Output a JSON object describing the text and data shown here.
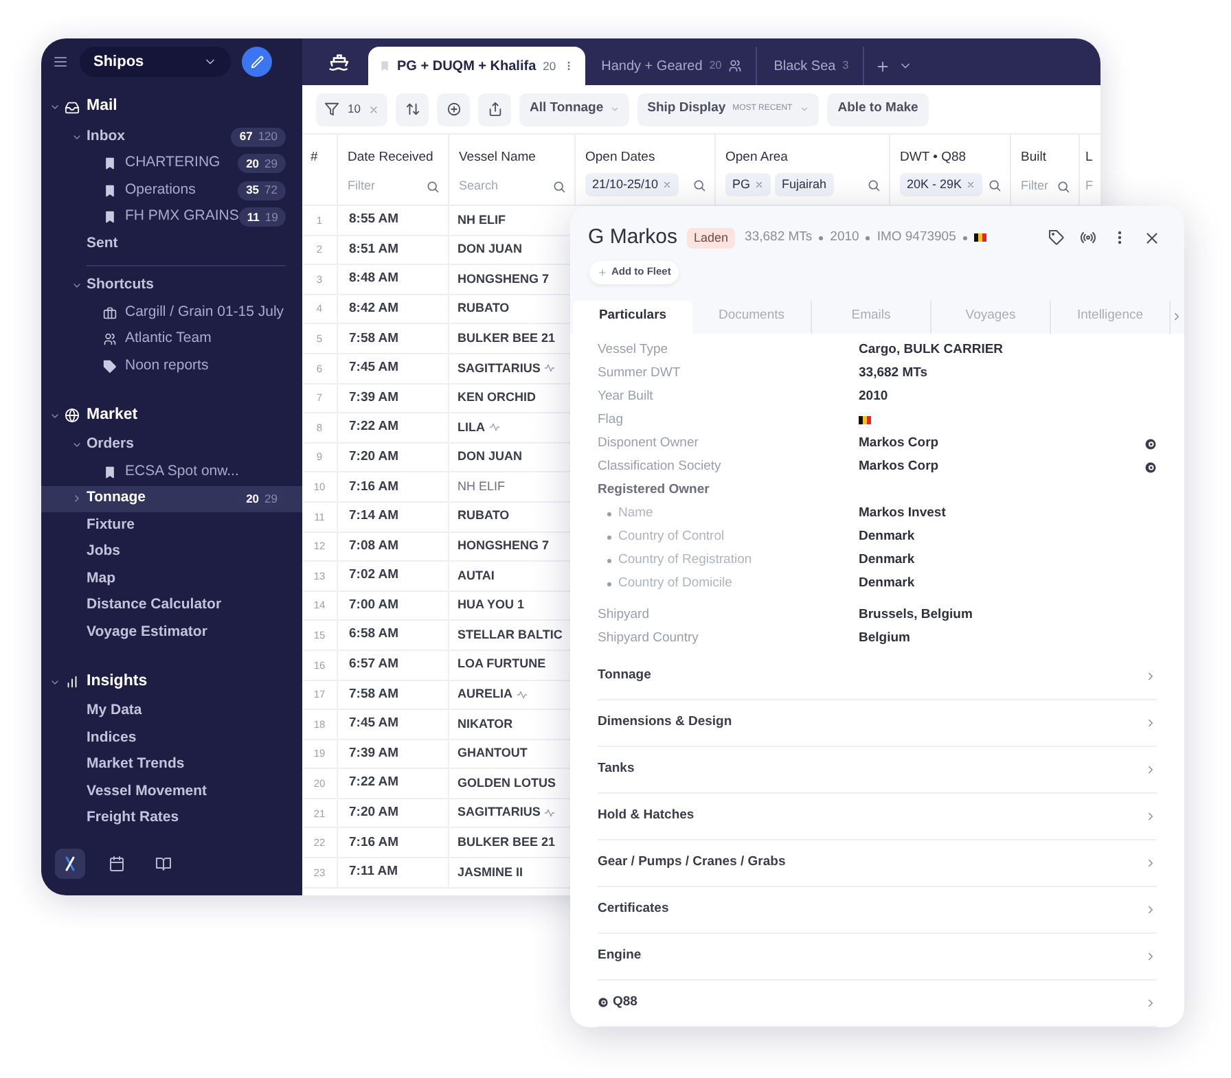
{
  "sidebar": {
    "workspace": "Shipos",
    "sections": [
      {
        "title": "Mail",
        "expanded": true,
        "items": [
          {
            "kind": "group",
            "label": "Inbox",
            "expanded": true,
            "selected": false,
            "counts": [
              "67",
              "120"
            ],
            "children": [
              {
                "kind": "bookmark",
                "label": "CHARTERING",
                "selected": false,
                "counts": [
                  "20",
                  "29"
                ]
              },
              {
                "kind": "bookmark",
                "label": "Operations",
                "selected": false,
                "counts": [
                  "35",
                  "72"
                ]
              },
              {
                "kind": "bookmark",
                "label": "FH PMX GRAINS",
                "selected": false,
                "counts": [
                  "11",
                  "19"
                ]
              }
            ]
          },
          {
            "kind": "link",
            "label": "Sent",
            "selected": false
          },
          {
            "kind": "group",
            "label": "Shortcuts",
            "expanded": true,
            "selected": false,
            "children": [
              {
                "kind": "briefcase",
                "label": "Cargill / Grain 01-15 July",
                "selected": false
              },
              {
                "kind": "team",
                "label": "Atlantic Team",
                "selected": false
              },
              {
                "kind": "tag",
                "label": "Noon reports",
                "selected": false
              }
            ]
          }
        ]
      },
      {
        "title": "Market",
        "expanded": true,
        "items": [
          {
            "kind": "group",
            "label": "Orders",
            "expanded": true,
            "selected": false,
            "children": [
              {
                "kind": "bookmark",
                "label": "ECSA Spot onw...",
                "selected": false
              }
            ]
          },
          {
            "kind": "group",
            "label": "Tonnage",
            "expanded": false,
            "selected": true,
            "counts": [
              "20",
              "29"
            ]
          },
          {
            "kind": "link",
            "label": "Fixture",
            "selected": false
          },
          {
            "kind": "link",
            "label": "Jobs",
            "selected": false
          },
          {
            "kind": "link",
            "label": "Map",
            "selected": false
          },
          {
            "kind": "link",
            "label": "Distance Calculator",
            "selected": false
          },
          {
            "kind": "link",
            "label": "Voyage Estimator",
            "selected": false
          }
        ]
      },
      {
        "title": "Insights",
        "expanded": true,
        "items": [
          {
            "kind": "link",
            "label": "My Data",
            "selected": false
          },
          {
            "kind": "link",
            "label": "Indices",
            "selected": false
          },
          {
            "kind": "link",
            "label": "Market Trends",
            "selected": false
          },
          {
            "kind": "link",
            "label": "Vessel Movement",
            "selected": false
          },
          {
            "kind": "link",
            "label": "Freight Rates",
            "selected": false
          }
        ]
      }
    ],
    "footer": [
      {
        "selected": true
      },
      {
        "selected": false
      },
      {
        "selected": false
      }
    ]
  },
  "tabs": [
    {
      "label": "PG + DUQM + Khalifa",
      "count": "20",
      "selected": true,
      "shared": false
    },
    {
      "label": "Handy + Geared",
      "count": "20",
      "selected": false,
      "shared": true
    },
    {
      "label": "Black Sea",
      "count": "3",
      "selected": false,
      "shared": false
    }
  ],
  "toolbar": {
    "filter_count": "10",
    "dropdowns": [
      {
        "label": "All Tonnage"
      },
      {
        "label": "Ship Display",
        "hint": "MOST RECENT"
      }
    ],
    "button": "Able to Make"
  },
  "table": {
    "columns": [
      {
        "label": "#"
      },
      {
        "label": "Date Received",
        "placeholder": "Filter"
      },
      {
        "label": "Vessel Name",
        "placeholder": "Search"
      },
      {
        "label": "Open Dates",
        "chips": [
          {
            "text": "21/10-25/10",
            "removable": true
          }
        ]
      },
      {
        "label": "Open Area",
        "chips": [
          {
            "text": "PG",
            "removable": true
          },
          {
            "text": "Fujairah",
            "removable": false
          }
        ]
      },
      {
        "label": "DWT • Q88",
        "chips": [
          {
            "text": "20K - 29K",
            "removable": true
          }
        ]
      },
      {
        "label": "Built",
        "placeholder": "Filter"
      },
      {
        "label": "L",
        "placeholder": "F"
      }
    ],
    "rows": [
      {
        "num": "1",
        "time": "8:55 AM",
        "vessel": "NH ELIF",
        "signal": false,
        "read": false
      },
      {
        "num": "2",
        "time": "8:51 AM",
        "vessel": "DON JUAN",
        "signal": false,
        "read": false
      },
      {
        "num": "3",
        "time": "8:48 AM",
        "vessel": "HONGSHENG 7",
        "signal": false,
        "read": false
      },
      {
        "num": "4",
        "time": "8:42 AM",
        "vessel": "RUBATO",
        "signal": false,
        "read": false
      },
      {
        "num": "5",
        "time": "7:58 AM",
        "vessel": "BULKER BEE 21",
        "signal": false,
        "read": false
      },
      {
        "num": "6",
        "time": "7:45 AM",
        "vessel": "SAGITTARIUS",
        "signal": true,
        "read": false
      },
      {
        "num": "7",
        "time": "7:39 AM",
        "vessel": "KEN ORCHID",
        "signal": false,
        "read": false
      },
      {
        "num": "8",
        "time": "7:22 AM",
        "vessel": "LILA",
        "signal": true,
        "read": false
      },
      {
        "num": "9",
        "time": "7:20 AM",
        "vessel": "DON JUAN",
        "signal": false,
        "read": false
      },
      {
        "num": "10",
        "time": "7:16 AM",
        "vessel": "NH ELIF",
        "signal": false,
        "read": true
      },
      {
        "num": "11",
        "time": "7:14 AM",
        "vessel": "RUBATO",
        "signal": false,
        "read": false
      },
      {
        "num": "12",
        "time": "7:08 AM",
        "vessel": "HONGSHENG 7",
        "signal": false,
        "read": false
      },
      {
        "num": "13",
        "time": "7:02 AM",
        "vessel": "AUTAI",
        "signal": false,
        "read": false
      },
      {
        "num": "14",
        "time": "7:00 AM",
        "vessel": "HUA YOU 1",
        "signal": false,
        "read": false
      },
      {
        "num": "15",
        "time": "6:58 AM",
        "vessel": "STELLAR BALTIC",
        "signal": false,
        "read": false
      },
      {
        "num": "16",
        "time": "6:57 AM",
        "vessel": "LOA FURTUNE",
        "signal": false,
        "read": false
      },
      {
        "num": "17",
        "time": "7:58 AM",
        "vessel": "AURELIA",
        "signal": true,
        "read": false
      },
      {
        "num": "18",
        "time": "7:45 AM",
        "vessel": "NIKATOR",
        "signal": false,
        "read": false
      },
      {
        "num": "19",
        "time": "7:39 AM",
        "vessel": "GHANTOUT",
        "signal": false,
        "read": false
      },
      {
        "num": "20",
        "time": "7:22 AM",
        "vessel": "GOLDEN LOTUS",
        "signal": false,
        "read": false
      },
      {
        "num": "21",
        "time": "7:20 AM",
        "vessel": "SAGITTARIUS",
        "signal": true,
        "read": false
      },
      {
        "num": "22",
        "time": "7:16 AM",
        "vessel": "BULKER BEE 21",
        "signal": false,
        "read": false
      },
      {
        "num": "23",
        "time": "7:11 AM",
        "vessel": "JASMINE II",
        "signal": false,
        "read": false
      }
    ]
  },
  "vessel_panel": {
    "title": "G Markos",
    "status": "Laden",
    "meta": [
      "33,682 MTs",
      "2010",
      "IMO 9473905"
    ],
    "add_button": "Add to Fleet",
    "tabs": [
      {
        "label": "Particulars",
        "selected": true
      },
      {
        "label": "Documents",
        "selected": false
      },
      {
        "label": "Emails",
        "selected": false
      },
      {
        "label": "Voyages",
        "selected": false
      },
      {
        "label": "Intelligence",
        "selected": false
      }
    ],
    "particulars": [
      {
        "kind": "field",
        "label": "Vessel Type",
        "value": "Cargo, BULK CARRIER",
        "logo": false
      },
      {
        "kind": "field",
        "label": "Summer DWT",
        "value": "33,682 MTs",
        "logo": false
      },
      {
        "kind": "field",
        "label": "Year Built",
        "value": "2010",
        "logo": false
      },
      {
        "kind": "flag",
        "label": "Flag"
      },
      {
        "kind": "field",
        "label": "Disponent Owner",
        "value": "Markos Corp",
        "logo": true
      },
      {
        "kind": "field",
        "label": "Classification Society",
        "value": "Markos Corp",
        "logo": true
      },
      {
        "kind": "heading",
        "label": "Registered Owner"
      },
      {
        "kind": "bullet",
        "label": "Name",
        "value": "Markos Invest"
      },
      {
        "kind": "bullet",
        "label": "Country of Control",
        "value": "Denmark"
      },
      {
        "kind": "bullet",
        "label": "Country of Registration",
        "value": "Denmark"
      },
      {
        "kind": "bullet",
        "label": "Country of Domicile",
        "value": "Denmark"
      },
      {
        "kind": "field",
        "label": "Shipyard",
        "value": "Brussels, Belgium",
        "logo": false
      },
      {
        "kind": "field",
        "label": "Shipyard Country",
        "value": "Belgium",
        "logo": false
      }
    ],
    "sections": [
      {
        "label": "Tonnage",
        "logo": false
      },
      {
        "label": "Dimensions & Design",
        "logo": false
      },
      {
        "label": "Tanks",
        "logo": false
      },
      {
        "label": "Hold & Hatches",
        "logo": false
      },
      {
        "label": "Gear / Pumps / Cranes / Grabs",
        "logo": false
      },
      {
        "label": "Certificates",
        "logo": false
      },
      {
        "label": "Engine",
        "logo": false
      },
      {
        "label": "Q88",
        "logo": true
      }
    ]
  }
}
